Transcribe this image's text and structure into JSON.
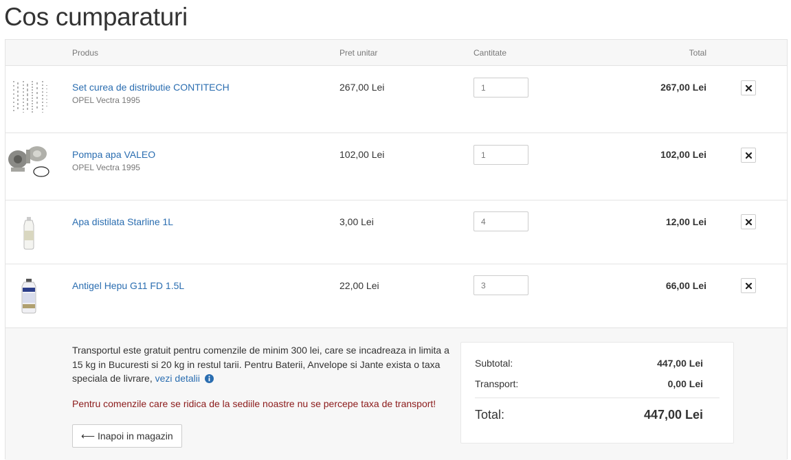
{
  "page": {
    "title": "Cos cumparaturi"
  },
  "table": {
    "headers": {
      "product": "Produs",
      "unit_price": "Pret unitar",
      "quantity": "Cantitate",
      "total": "Total"
    },
    "items": [
      {
        "name": "Set curea de distributie CONTITECH",
        "meta": "OPEL Vectra 1995",
        "unit_price": "267,00 Lei",
        "quantity": "1",
        "total": "267,00 Lei",
        "image": "timing-belt-kit"
      },
      {
        "name": "Pompa apa VALEO",
        "meta": "OPEL Vectra 1995",
        "unit_price": "102,00 Lei",
        "quantity": "1",
        "total": "102,00 Lei",
        "image": "water-pump"
      },
      {
        "name": "Apa distilata Starline 1L",
        "meta": "",
        "unit_price": "3,00 Lei",
        "quantity": "4",
        "total": "12,00 Lei",
        "image": "distilled-water-bottle"
      },
      {
        "name": "Antigel Hepu G11 FD 1.5L",
        "meta": "",
        "unit_price": "22,00 Lei",
        "quantity": "3",
        "total": "66,00 Lei",
        "image": "antifreeze-bottle"
      }
    ],
    "remove_icon": "close-x-icon"
  },
  "footer": {
    "shipping_note": "Transportul este gratuit pentru comenzile de minim 300 lei, care se incadreaza in limita a 15 kg in Bucuresti si 20 kg in restul tarii. Pentru Baterii, Anvelope si Jante exista o taxa speciala de livrare,",
    "shipping_link": "vezi detalii",
    "pickup_note": "Pentru comenzile care se ridica de la sediile noastre nu se percepe taxa de transport!",
    "back_button": "⟵ Inapoi in magazin"
  },
  "summary": {
    "subtotal_label": "Subtotal:",
    "subtotal_value": "447,00 Lei",
    "transport_label": "Transport:",
    "transport_value": "0,00 Lei",
    "total_label": "Total:",
    "total_value": "447,00 Lei"
  },
  "colors": {
    "link": "#2a6db0",
    "notice": "#8b1a1a",
    "header_bg": "#f7f7f7"
  }
}
